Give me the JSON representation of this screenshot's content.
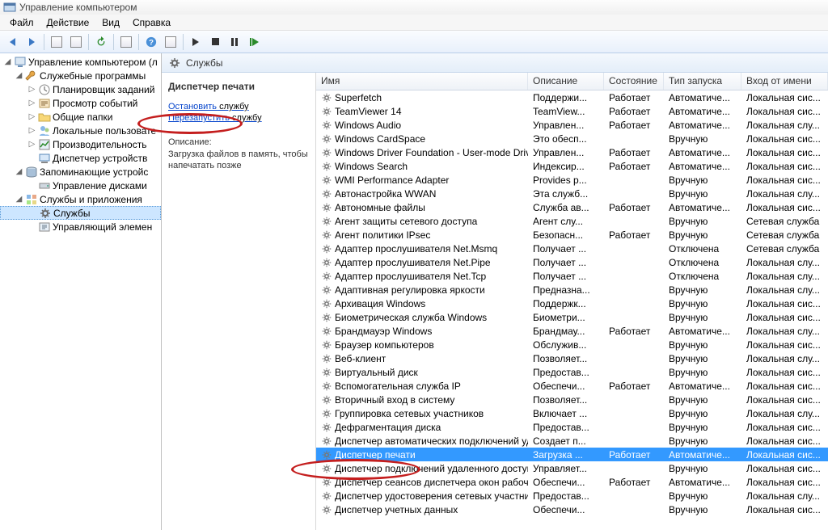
{
  "window": {
    "title": "Управление компьютером"
  },
  "menu": {
    "file": "Файл",
    "action": "Действие",
    "view": "Вид",
    "help": "Справка"
  },
  "tree": {
    "root": "Управление компьютером (л",
    "utilities": "Служебные программы",
    "scheduler": "Планировщик заданий",
    "events": "Просмотр событий",
    "shared": "Общие папки",
    "users": "Локальные пользовате",
    "perf": "Производительность",
    "devmgr": "Диспетчер устройств",
    "storage": "Запоминающие устройс",
    "diskmgr": "Управление дисками",
    "apps": "Службы и приложения",
    "services": "Службы",
    "wmi": "Управляющий элемен"
  },
  "header": {
    "label": "Службы"
  },
  "detail": {
    "service_name": "Диспетчер печати",
    "stop_link": "Остановить",
    "stop_suffix": " службу",
    "restart_link": "Перезапустить",
    "restart_suffix": " службу",
    "desc_label": "Описание:",
    "desc_text": "Загрузка файлов в память, чтобы напечатать позже"
  },
  "columns": {
    "name": "Имя",
    "desc": "Описание",
    "state": "Состояние",
    "startup": "Тип запуска",
    "logon": "Вход от имени"
  },
  "services": [
    {
      "name": "Superfetch",
      "desc": "Поддержи...",
      "state": "Работает",
      "startup": "Автоматиче...",
      "logon": "Локальная сис..."
    },
    {
      "name": "TeamViewer 14",
      "desc": "TeamView...",
      "state": "Работает",
      "startup": "Автоматиче...",
      "logon": "Локальная сис..."
    },
    {
      "name": "Windows Audio",
      "desc": "Управлен...",
      "state": "Работает",
      "startup": "Автоматиче...",
      "logon": "Локальная слу..."
    },
    {
      "name": "Windows CardSpace",
      "desc": "Это обесп...",
      "state": "",
      "startup": "Вручную",
      "logon": "Локальная сис..."
    },
    {
      "name": "Windows Driver Foundation - User-mode Driver Fra...",
      "desc": "Управлен...",
      "state": "Работает",
      "startup": "Автоматиче...",
      "logon": "Локальная сис..."
    },
    {
      "name": "Windows Search",
      "desc": "Индексир...",
      "state": "Работает",
      "startup": "Автоматиче...",
      "logon": "Локальная сис..."
    },
    {
      "name": "WMI Performance Adapter",
      "desc": "Provides p...",
      "state": "",
      "startup": "Вручную",
      "logon": "Локальная сис..."
    },
    {
      "name": "Автонастройка WWAN",
      "desc": "Эта служб...",
      "state": "",
      "startup": "Вручную",
      "logon": "Локальная слу..."
    },
    {
      "name": "Автономные файлы",
      "desc": "Служба ав...",
      "state": "Работает",
      "startup": "Автоматиче...",
      "logon": "Локальная сис..."
    },
    {
      "name": "Агент защиты сетевого доступа",
      "desc": "Агент слу...",
      "state": "",
      "startup": "Вручную",
      "logon": "Сетевая служба"
    },
    {
      "name": "Агент политики IPsec",
      "desc": "Безопасн...",
      "state": "Работает",
      "startup": "Вручную",
      "logon": "Сетевая служба"
    },
    {
      "name": "Адаптер прослушивателя Net.Msmq",
      "desc": "Получает ...",
      "state": "",
      "startup": "Отключена",
      "logon": "Сетевая служба"
    },
    {
      "name": "Адаптер прослушивателя Net.Pipe",
      "desc": "Получает ...",
      "state": "",
      "startup": "Отключена",
      "logon": "Локальная слу..."
    },
    {
      "name": "Адаптер прослушивателя Net.Tcp",
      "desc": "Получает ...",
      "state": "",
      "startup": "Отключена",
      "logon": "Локальная слу..."
    },
    {
      "name": "Адаптивная регулировка яркости",
      "desc": "Предназна...",
      "state": "",
      "startup": "Вручную",
      "logon": "Локальная слу..."
    },
    {
      "name": "Архивация Windows",
      "desc": "Поддержк...",
      "state": "",
      "startup": "Вручную",
      "logon": "Локальная сис..."
    },
    {
      "name": "Биометрическая служба Windows",
      "desc": "Биометри...",
      "state": "",
      "startup": "Вручную",
      "logon": "Локальная сис..."
    },
    {
      "name": "Брандмауэр Windows",
      "desc": "Брандмау...",
      "state": "Работает",
      "startup": "Автоматиче...",
      "logon": "Локальная слу..."
    },
    {
      "name": "Браузер компьютеров",
      "desc": "Обслужив...",
      "state": "",
      "startup": "Вручную",
      "logon": "Локальная сис..."
    },
    {
      "name": "Веб-клиент",
      "desc": "Позволяет...",
      "state": "",
      "startup": "Вручную",
      "logon": "Локальная слу..."
    },
    {
      "name": "Виртуальный диск",
      "desc": "Предостав...",
      "state": "",
      "startup": "Вручную",
      "logon": "Локальная сис..."
    },
    {
      "name": "Вспомогательная служба IP",
      "desc": "Обеспечи...",
      "state": "Работает",
      "startup": "Автоматиче...",
      "logon": "Локальная сис..."
    },
    {
      "name": "Вторичный вход в систему",
      "desc": "Позволяет...",
      "state": "",
      "startup": "Вручную",
      "logon": "Локальная сис..."
    },
    {
      "name": "Группировка сетевых участников",
      "desc": "Включает ...",
      "state": "",
      "startup": "Вручную",
      "logon": "Локальная слу..."
    },
    {
      "name": "Дефрагментация диска",
      "desc": "Предостав...",
      "state": "",
      "startup": "Вручную",
      "logon": "Локальная сис..."
    },
    {
      "name": "Диспетчер автоматических подключений удален...",
      "desc": "Создает п...",
      "state": "",
      "startup": "Вручную",
      "logon": "Локальная сис..."
    },
    {
      "name": "Диспетчер печати",
      "desc": "Загрузка ...",
      "state": "Работает",
      "startup": "Автоматиче...",
      "logon": "Локальная сис...",
      "selected": true
    },
    {
      "name": "Диспетчер подключений удаленного доступа",
      "desc": "Управляет...",
      "state": "",
      "startup": "Вручную",
      "logon": "Локальная сис..."
    },
    {
      "name": "Диспетчер сеансов диспетчера окон рабочего с...",
      "desc": "Обеспечи...",
      "state": "Работает",
      "startup": "Автоматиче...",
      "logon": "Локальная сис..."
    },
    {
      "name": "Диспетчер удостоверения сетевых участников",
      "desc": "Предостав...",
      "state": "",
      "startup": "Вручную",
      "logon": "Локальная слу..."
    },
    {
      "name": "Диспетчер учетных данных",
      "desc": "Обеспечи...",
      "state": "",
      "startup": "Вручную",
      "logon": "Локальная сис..."
    }
  ]
}
